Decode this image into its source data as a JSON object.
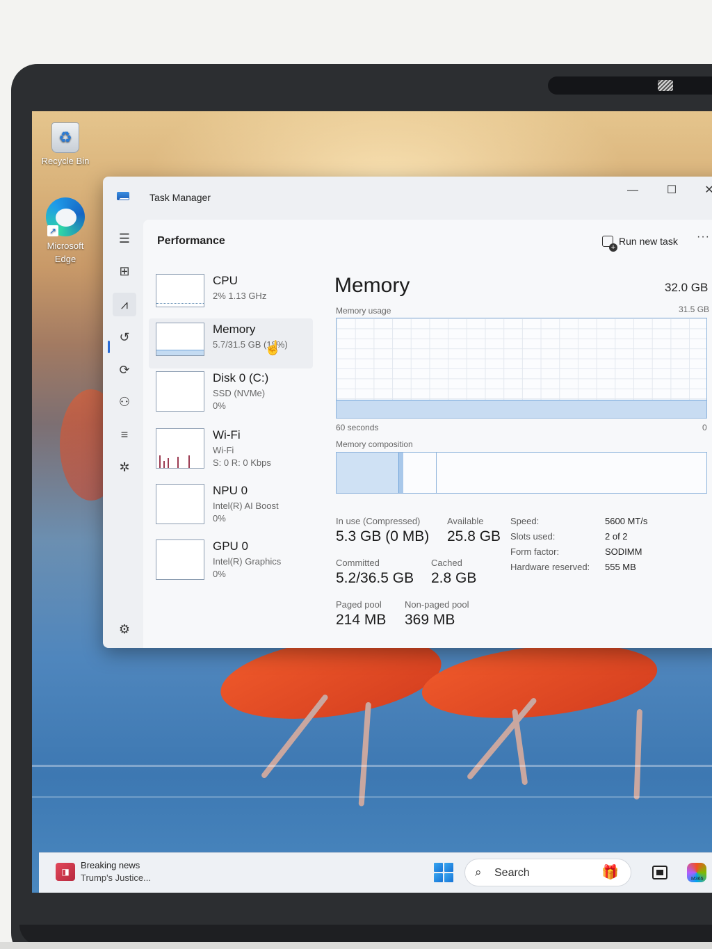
{
  "desktop": {
    "icons": [
      {
        "label": "Recycle Bin",
        "glyph": "♻"
      },
      {
        "label": "Microsoft Edge",
        "shortcut_glyph": "↗"
      }
    ]
  },
  "window": {
    "title": "Task Manager",
    "controls": {
      "minimize": "—",
      "maximize": "☐",
      "close": "✕"
    }
  },
  "nav": {
    "items": [
      {
        "name": "hamburger-menu-icon",
        "glyph": "☰"
      },
      {
        "name": "processes-icon",
        "glyph": "⊞"
      },
      {
        "name": "performance-icon",
        "glyph": "⩘",
        "active": true
      },
      {
        "name": "app-history-icon",
        "glyph": "↺"
      },
      {
        "name": "startup-apps-icon",
        "glyph": "⟳"
      },
      {
        "name": "users-icon",
        "glyph": "⚇"
      },
      {
        "name": "details-icon",
        "glyph": "≡"
      },
      {
        "name": "services-icon",
        "glyph": "✲"
      }
    ],
    "settings_glyph": "⚙"
  },
  "header": {
    "section_title": "Performance",
    "run_new_task": "Run new task",
    "more": "···"
  },
  "resources": [
    {
      "name": "CPU",
      "sub": "2%  1.13 GHz",
      "sub2": ""
    },
    {
      "name": "Memory",
      "sub": "5.7/31.5 GB (18%)",
      "sub2": "",
      "selected": true
    },
    {
      "name": "Disk 0 (C:)",
      "sub": "SSD (NVMe)",
      "sub2": "0%"
    },
    {
      "name": "Wi-Fi",
      "sub": "Wi-Fi",
      "sub2": "S: 0 R: 0 Kbps"
    },
    {
      "name": "NPU 0",
      "sub": "Intel(R) AI Boost",
      "sub2": "0%"
    },
    {
      "name": "GPU 0",
      "sub": "Intel(R) Graphics",
      "sub2": "0%"
    }
  ],
  "memory": {
    "title": "Memory",
    "total": "32.0 GB",
    "usage_label": "Memory usage",
    "usage_max": "31.5 GB",
    "time_left": "60 seconds",
    "time_right": "0",
    "composition_label": "Memory composition",
    "usage_fraction": 0.18,
    "composition": {
      "in_use_fraction": 0.168,
      "modified_fraction": 0.012,
      "standby_fraction": 0.089
    },
    "stats": {
      "in_use_label": "In use (Compressed)",
      "in_use_value": "5.3 GB (0 MB)",
      "available_label": "Available",
      "available_value": "25.8 GB",
      "committed_label": "Committed",
      "committed_value": "5.2/36.5 GB",
      "cached_label": "Cached",
      "cached_value": "2.8 GB",
      "paged_label": "Paged pool",
      "paged_value": "214 MB",
      "nonpaged_label": "Non-paged pool",
      "nonpaged_value": "369 MB"
    },
    "specs": [
      {
        "label": "Speed:",
        "value": "5600 MT/s"
      },
      {
        "label": "Slots used:",
        "value": "2 of 2"
      },
      {
        "label": "Form factor:",
        "value": "SODIMM"
      },
      {
        "label": "Hardware reserved:",
        "value": "555 MB"
      }
    ]
  },
  "taskbar": {
    "news_title": "Breaking news",
    "news_sub": "Trump's Justice...",
    "news_glyph": "◨",
    "search_placeholder": "Search",
    "search_glyph": "⌕",
    "search_deco": "🎁",
    "m365_label": "M365"
  }
}
